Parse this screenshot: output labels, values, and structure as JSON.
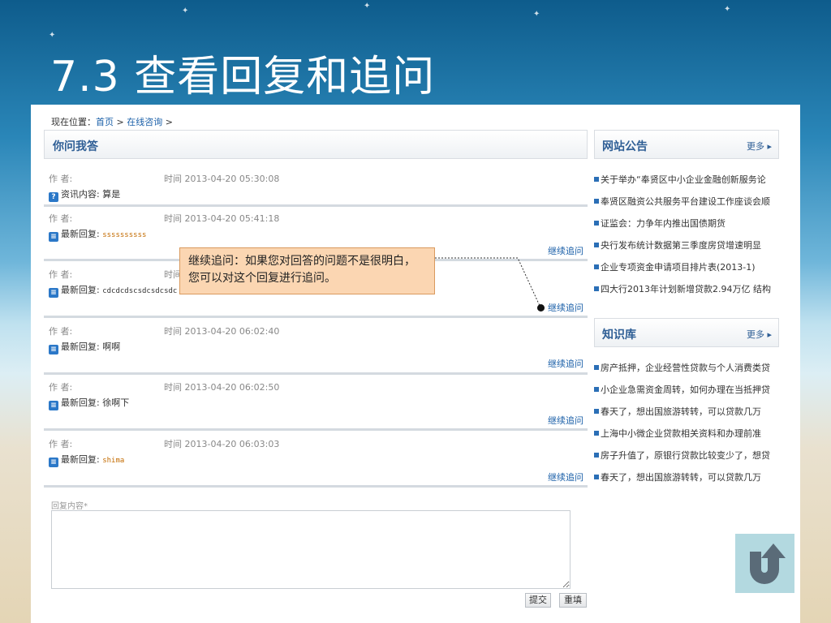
{
  "slide": {
    "title": "7.3 查看回复和追问"
  },
  "breadcrumb": {
    "prefix": "现在位置：",
    "home": "首页",
    "sep1": " > ",
    "section": "在线咨询",
    "sep2": " >"
  },
  "main": {
    "header": "你问我答",
    "entries": [
      {
        "author": "作 者:",
        "time": "时间 2013-04-20 05:30:08",
        "label": "资讯内容:",
        "value": "算是",
        "icon": "question-icon",
        "follow": ""
      },
      {
        "author": "作 者:",
        "time": "时间 2013-04-20 05:41:18",
        "label": "最新回复:",
        "value": "ssssssssss",
        "icon": "reply-icon",
        "follow": "继续追问"
      },
      {
        "author": "作 者:",
        "time": "时间",
        "label": "最新回复:",
        "value": "cdcdcdscsdcsdcsdc",
        "icon": "reply-icon",
        "follow": "继续追问"
      },
      {
        "author": "作 者:",
        "time": "时间 2013-04-20 06:02:40",
        "label": "最新回复:",
        "value": "啊啊",
        "icon": "reply-icon",
        "follow": "继续追问"
      },
      {
        "author": "作 者:",
        "time": "时间 2013-04-20 06:02:50",
        "label": "最新回复:",
        "value": "徐啊下",
        "icon": "reply-icon",
        "follow": "继续追问"
      },
      {
        "author": "作 者:",
        "time": "时间 2013-04-20 06:03:03",
        "label": "最新回复:",
        "value": "shima",
        "icon": "reply-icon",
        "follow": "继续追问"
      }
    ],
    "callout": "继续追问：如果您对回答的问题不是很明白，您可以对这个回复进行追问。",
    "reply": {
      "label": "回复内容*",
      "value": "",
      "submit": "提交",
      "reset": "重填"
    }
  },
  "sidebar": {
    "notice": {
      "title": "网站公告",
      "more": "更多 ▸",
      "items": [
        "关于举办“奉贤区中小企业金融创新服务论",
        "奉贤区融资公共服务平台建设工作座谈会顺",
        "证监会：力争年内推出国债期货",
        "央行发布统计数据第三季度房贷增速明显",
        "企业专项资金申请项目排片表(2013-1)",
        "四大行2013年计划新增贷款2.94万亿 结构"
      ]
    },
    "knowledge": {
      "title": "知识库",
      "more": "更多 ▸",
      "items": [
        "房产抵押，企业经营性贷款与个人消费类贷",
        "小企业急需资金周转，如何办理在当抵押贷",
        "春天了，想出国旅游转转，可以贷款几万",
        "上海中小微企业贷款相关资料和办理前准",
        "房子升值了，原银行贷款比较变少了，想贷",
        "春天了，想出国旅游转转，可以贷款几万"
      ]
    }
  },
  "colors": {
    "accent": "#2e5e95",
    "link": "#1a5fa8",
    "callout_bg": "#fbd6b2",
    "back_button": "#b3d9e0",
    "back_arrow": "#5a6b78"
  }
}
